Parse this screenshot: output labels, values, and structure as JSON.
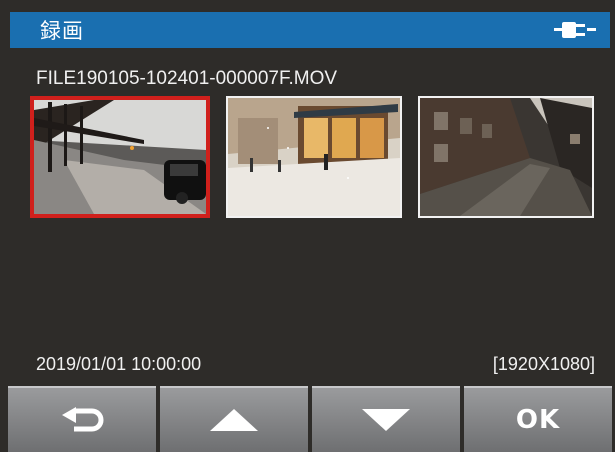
{
  "header": {
    "title": "録画",
    "status_icon": "power-plug-icon",
    "accent_color": "#1a6fb0"
  },
  "file": {
    "name": "FILE190105-102401-000007F.MOV",
    "datetime": "2019/01/01 10:00:00",
    "resolution": "[1920X1080]"
  },
  "thumbnails": [
    {
      "name": "bridge-night-scene",
      "selected": true
    },
    {
      "name": "snowy-street-scene",
      "selected": false
    },
    {
      "name": "alley-evening-scene",
      "selected": false
    }
  ],
  "selection_color": "#d0201c",
  "buttons": {
    "back_icon": "return-arrow-icon",
    "up_icon": "triangle-up-icon",
    "down_icon": "triangle-down-icon",
    "ok_label": "OK"
  }
}
